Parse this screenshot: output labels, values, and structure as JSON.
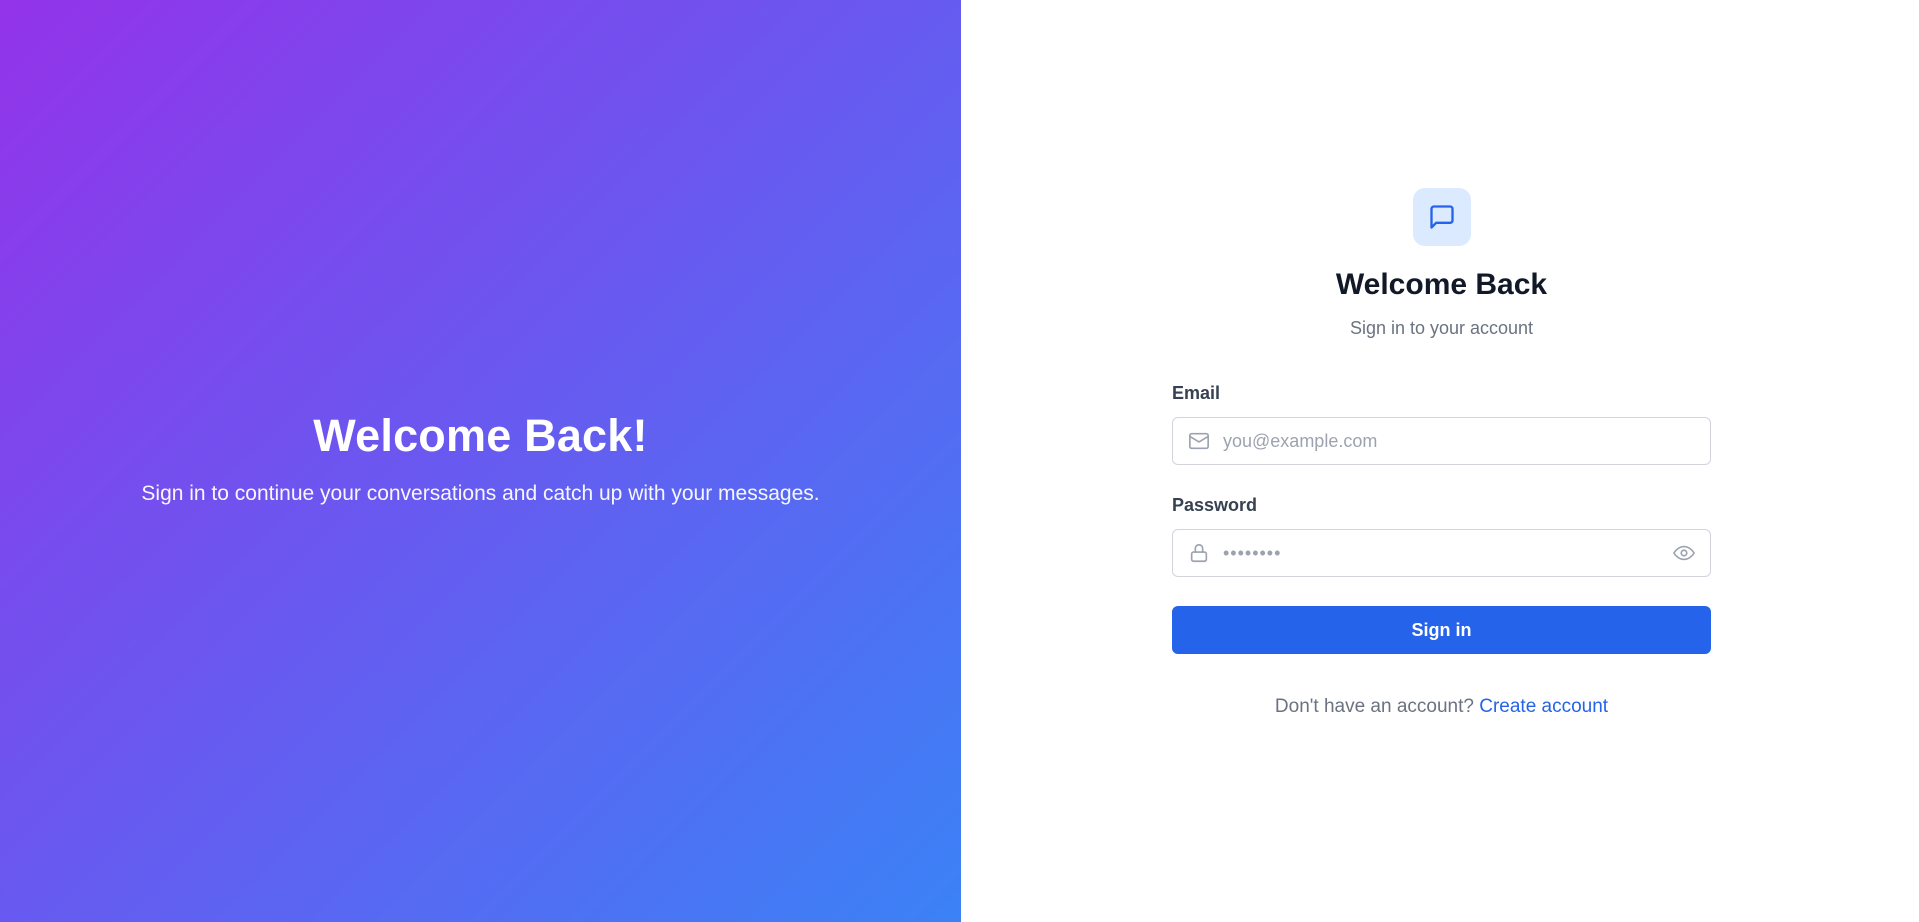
{
  "colors": {
    "gradient_start": "#9333ea",
    "gradient_end": "#3b82f6",
    "primary": "#2563eb",
    "logo_bg": "#dbeafe",
    "icon_gray": "#9ca3af"
  },
  "hero": {
    "title": "Welcome Back!",
    "subtitle": "Sign in to continue your conversations and catch up with your messages."
  },
  "form": {
    "logo_icon": "message-square-icon",
    "title": "Welcome Back",
    "subtitle": "Sign in to your account",
    "email": {
      "label": "Email",
      "icon": "mail-icon",
      "placeholder": "you@example.com",
      "value": ""
    },
    "password": {
      "label": "Password",
      "icon": "lock-icon",
      "placeholder": "••••••••",
      "value": "",
      "toggle_icon": "eye-icon"
    },
    "submit_label": "Sign in",
    "signup_prompt": "Don't have an account?",
    "signup_link": "Create account"
  }
}
